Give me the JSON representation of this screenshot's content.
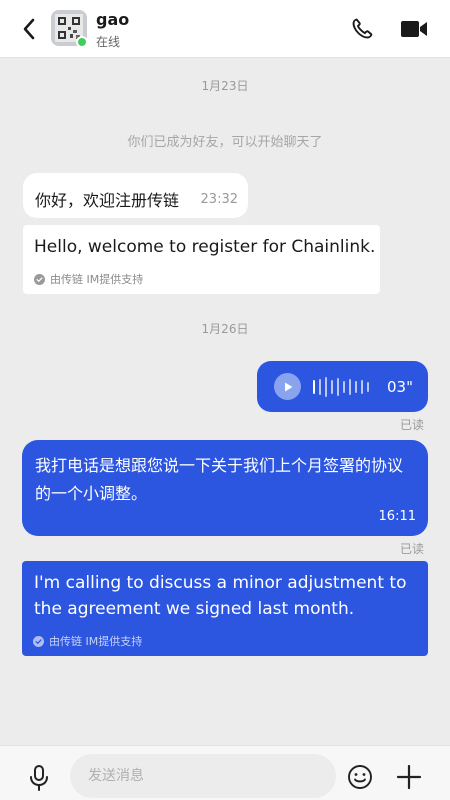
{
  "header": {
    "contact_name": "gao",
    "status": "在线",
    "icons": {
      "back": "chevron-left-icon",
      "call": "phone-icon",
      "video": "video-camera-icon",
      "online": "online-dot"
    }
  },
  "colors": {
    "accent_bubble": "#2c55e0",
    "online": "#3ccf5a",
    "background": "#ececec"
  },
  "chat": {
    "date_1": "1月23日",
    "system_note": "你们已成为好友，可以开始聊天了",
    "msg1": {
      "text": "你好，欢迎注册传链",
      "time": "23:32",
      "translation": "Hello, welcome to register for Chainlink.",
      "translation_badge": "由传链 IM提供支持"
    },
    "date_2": "1月26日",
    "voice_msg": {
      "duration": "03\"",
      "read_status": "已读"
    },
    "msg2": {
      "text": "我打电话是想跟您说一下关于我们上个月签署的协议的一个小调整。",
      "time": "16:11",
      "read_status": "已读",
      "translation": "I'm calling to discuss a minor adjustment to the agreement we signed last month.",
      "translation_badge": "由传链 IM提供支持"
    }
  },
  "input_bar": {
    "placeholder": "发送消息",
    "icons": {
      "mic": "microphone-icon",
      "emoji": "smiley-icon",
      "more": "plus-icon"
    }
  }
}
